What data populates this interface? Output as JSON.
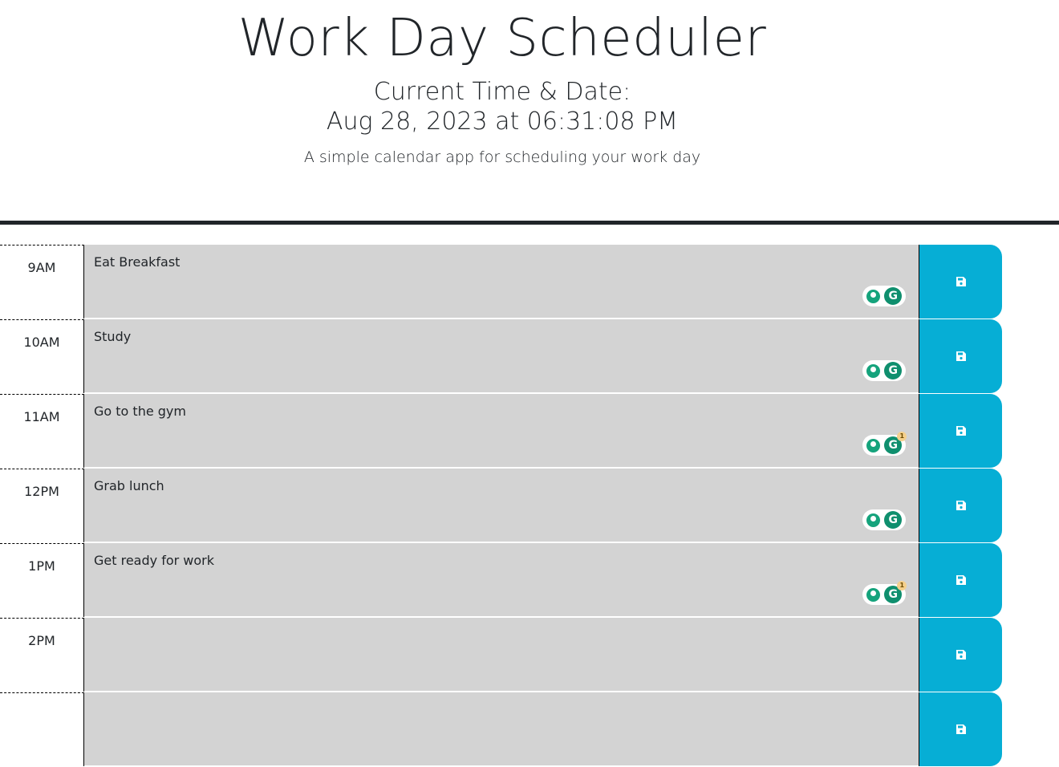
{
  "header": {
    "title": "Work Day Scheduler",
    "current_label": "Current Time & Date:",
    "current_value": "Aug 28, 2023 at 06:31:08 PM",
    "lead": "A simple calendar app for scheduling your work day"
  },
  "colors": {
    "slot_background": "#d3d3d3",
    "save_button": "#06aed5",
    "divider": "#212529"
  },
  "icons": {
    "save": "floppy-disk-icon",
    "assistant_suggest": "lightbulb-icon",
    "assistant_logo": "grammarly-icon"
  },
  "rows": [
    {
      "hour": "9AM",
      "text": "Eat Breakfast",
      "assistant": true,
      "badge": ""
    },
    {
      "hour": "10AM",
      "text": "Study",
      "assistant": true,
      "badge": ""
    },
    {
      "hour": "11AM",
      "text": "Go to the gym",
      "assistant": true,
      "badge": "1"
    },
    {
      "hour": "12PM",
      "text": "Grab lunch",
      "assistant": true,
      "badge": ""
    },
    {
      "hour": "1PM",
      "text": "Get ready for work",
      "assistant": true,
      "badge": "1"
    },
    {
      "hour": "2PM",
      "text": "",
      "assistant": false,
      "badge": ""
    },
    {
      "hour": "",
      "text": "",
      "assistant": false,
      "badge": ""
    }
  ]
}
